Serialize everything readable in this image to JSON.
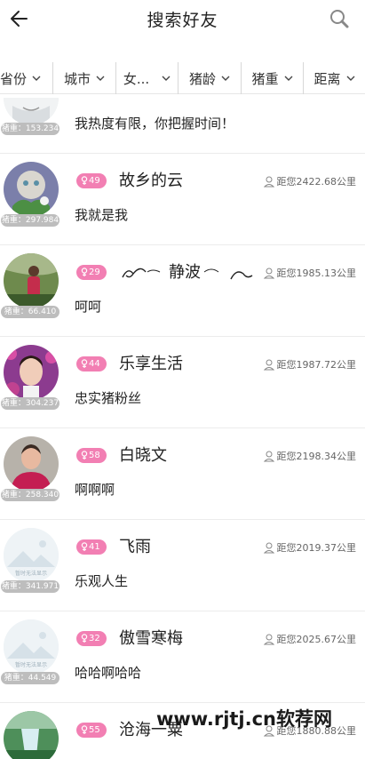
{
  "header": {
    "title": "搜索好友"
  },
  "filters": [
    {
      "label": "省份"
    },
    {
      "label": "城市"
    },
    {
      "label": "女..."
    },
    {
      "label": "猪龄"
    },
    {
      "label": "猪重"
    },
    {
      "label": "距离"
    }
  ],
  "users": [
    {
      "weight": "猪重：153.234",
      "signature": "我热度有限，你把握时间！",
      "name": "",
      "age": "",
      "distance": ""
    },
    {
      "weight": "猪重：297.984",
      "age": "49",
      "name": "故乡的云",
      "distance": "距您2422.68公里",
      "signature": "我就是我"
    },
    {
      "weight": "猪重：66.410",
      "age": "29",
      "name": "静波",
      "distance": "距您1985.13公里",
      "signature": "呵呵"
    },
    {
      "weight": "猪重：304.237",
      "age": "44",
      "name": "乐享生活",
      "distance": "距您1987.72公里",
      "signature": "忠实猪粉丝"
    },
    {
      "weight": "猪重：258.340",
      "age": "58",
      "name": "白晓文",
      "distance": "距您2198.34公里",
      "signature": "啊啊啊"
    },
    {
      "weight": "猪重：341.971",
      "age": "41",
      "name": "飞雨",
      "distance": "距您2019.37公里",
      "signature": "乐观人生",
      "avatar_caption": "暂时无法显示"
    },
    {
      "weight": "猪重：44.549",
      "age": "32",
      "name": "傲雪寒梅",
      "distance": "距您2025.67公里",
      "signature": "哈哈啊哈哈",
      "avatar_caption": "暂时无法显示"
    },
    {
      "weight": "",
      "age": "55",
      "name": "沧海一粟",
      "distance": "距您1880.88公里",
      "signature": ""
    }
  ],
  "watermark": "www.rjtj.cn软荐网",
  "colors": {
    "badge": "#f27fb3",
    "weight_pill": "#bdbdbd"
  },
  "icons": {
    "back": "arrow-left-icon",
    "search": "magnifier-icon",
    "pin": "person-pin-icon",
    "gender": "female-icon"
  }
}
